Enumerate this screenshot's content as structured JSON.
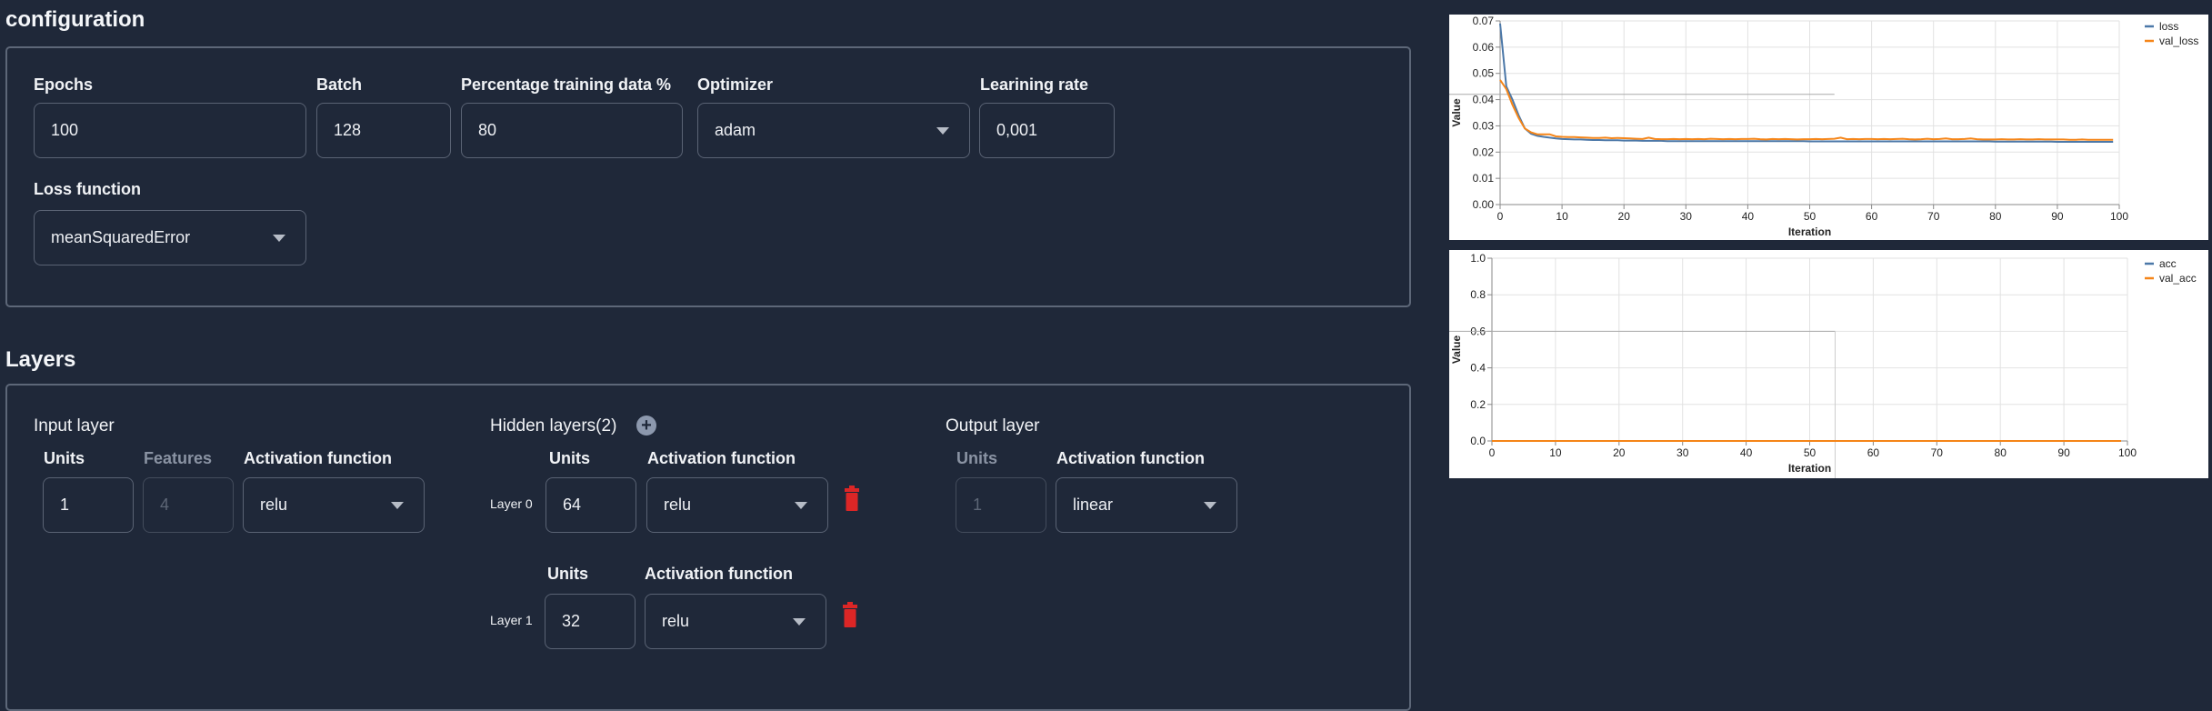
{
  "config": {
    "title": "configuration",
    "epochs": {
      "label": "Epochs",
      "value": "100"
    },
    "batch": {
      "label": "Batch",
      "value": "128"
    },
    "percentage": {
      "label": "Percentage training data %",
      "value": "80"
    },
    "optimizer": {
      "label": "Optimizer",
      "value": "adam"
    },
    "learning_rate": {
      "label": "Learining rate",
      "value": "0,001"
    },
    "loss_function": {
      "label": "Loss function",
      "value": "meanSquaredError"
    }
  },
  "layers": {
    "title": "Layers",
    "input": {
      "title": "Input layer",
      "units_label": "Units",
      "units": "1",
      "features_label": "Features",
      "features": "4",
      "activation_label": "Activation function",
      "activation": "relu"
    },
    "hidden": {
      "title": "Hidden layers(2)",
      "items": [
        {
          "name": "Layer 0",
          "units_label": "Units",
          "units": "64",
          "activation_label": "Activation function",
          "activation": "relu"
        },
        {
          "name": "Layer 1",
          "units_label": "Units",
          "units": "32",
          "activation_label": "Activation function",
          "activation": "relu"
        }
      ]
    },
    "output": {
      "title": "Output layer",
      "units_label": "Units",
      "units": "1",
      "activation_label": "Activation function",
      "activation": "linear"
    }
  },
  "colors": {
    "accent_delete": "#dc2626",
    "series_1": "#4c78a8",
    "series_2": "#f58518"
  },
  "chart_data": [
    {
      "type": "line",
      "xlabel": "Iteration",
      "ylabel": "Value",
      "xlim": [
        0,
        100
      ],
      "ylim": [
        0,
        0.07
      ],
      "xticks": [
        "0",
        "10",
        "20",
        "30",
        "40",
        "50",
        "60",
        "70",
        "80",
        "90",
        "100"
      ],
      "yticks": [
        "0.00",
        "0.01",
        "0.02",
        "0.03",
        "0.04",
        "0.05",
        "0.06",
        "0.07"
      ],
      "grid": true,
      "legend": "top-right",
      "series": [
        {
          "name": "loss",
          "values": [
            0.069,
            0.045,
            0.04,
            0.034,
            0.029,
            0.027,
            0.0262,
            0.0258,
            0.0255,
            0.0252,
            0.025,
            0.0249,
            0.0248,
            0.0248,
            0.0247,
            0.0246,
            0.0246,
            0.0245,
            0.0245,
            0.0245,
            0.0244,
            0.0244,
            0.0244,
            0.0243,
            0.0243,
            0.0243,
            0.0243,
            0.0242,
            0.0242,
            0.0242,
            0.0242,
            0.0242,
            0.0242,
            0.0242,
            0.0242,
            0.0242,
            0.0242,
            0.0242,
            0.0242,
            0.0242,
            0.0242,
            0.0242,
            0.0242,
            0.0242,
            0.0242,
            0.0242,
            0.0242,
            0.0242,
            0.0242,
            0.0242,
            0.0241,
            0.0241,
            0.0241,
            0.0241,
            0.0241,
            0.0241,
            0.0241,
            0.0241,
            0.0241,
            0.0241,
            0.0241,
            0.0241,
            0.0241,
            0.0241,
            0.0241,
            0.0241,
            0.0241,
            0.0241,
            0.0241,
            0.0241,
            0.0241,
            0.0241,
            0.0241,
            0.0241,
            0.0241,
            0.0241,
            0.0241,
            0.0241,
            0.0241,
            0.0241,
            0.024,
            0.024,
            0.024,
            0.024,
            0.024,
            0.024,
            0.024,
            0.024,
            0.024,
            0.024,
            0.0239,
            0.0239,
            0.0239,
            0.0239,
            0.0239,
            0.0239,
            0.0239,
            0.0239,
            0.0239,
            0.0239
          ]
        },
        {
          "name": "val_loss",
          "values": [
            0.0475,
            0.044,
            0.038,
            0.033,
            0.029,
            0.0275,
            0.0268,
            0.0268,
            0.0268,
            0.026,
            0.0258,
            0.0257,
            0.0257,
            0.0256,
            0.0255,
            0.0254,
            0.0254,
            0.0255,
            0.0253,
            0.0254,
            0.0253,
            0.0252,
            0.0251,
            0.025,
            0.0255,
            0.025,
            0.0249,
            0.0249,
            0.025,
            0.0249,
            0.025,
            0.0249,
            0.025,
            0.0249,
            0.0251,
            0.025,
            0.0249,
            0.025,
            0.0249,
            0.025,
            0.025,
            0.0251,
            0.0249,
            0.0248,
            0.025,
            0.0249,
            0.025,
            0.0249,
            0.0248,
            0.0249,
            0.0249,
            0.025,
            0.0249,
            0.025,
            0.0251,
            0.0255,
            0.0249,
            0.025,
            0.0249,
            0.025,
            0.025,
            0.0249,
            0.025,
            0.0249,
            0.025,
            0.0251,
            0.0249,
            0.0248,
            0.0249,
            0.0251,
            0.0249,
            0.025,
            0.0252,
            0.0249,
            0.0249,
            0.025,
            0.0252,
            0.0249,
            0.0248,
            0.0248,
            0.0248,
            0.0249,
            0.0248,
            0.0248,
            0.0249,
            0.0248,
            0.0248,
            0.0249,
            0.0248,
            0.0248,
            0.0248,
            0.0248,
            0.0247,
            0.0247,
            0.0248,
            0.0247,
            0.0247,
            0.0247,
            0.0247,
            0.0247
          ]
        }
      ]
    },
    {
      "type": "line",
      "xlabel": "Iteration",
      "ylabel": "Value",
      "xlim": [
        0,
        100
      ],
      "ylim": [
        0,
        1
      ],
      "xticks": [
        "0",
        "10",
        "20",
        "30",
        "40",
        "50",
        "60",
        "70",
        "80",
        "90",
        "100"
      ],
      "yticks": [
        "0.0",
        "0.2",
        "0.4",
        "0.6",
        "0.8",
        "1.0"
      ],
      "grid": true,
      "legend": "top-right",
      "series": [
        {
          "name": "acc",
          "values": [
            0,
            0,
            0,
            0,
            0,
            0,
            0,
            0,
            0,
            0,
            0,
            0,
            0,
            0,
            0,
            0,
            0,
            0,
            0,
            0,
            0,
            0,
            0,
            0,
            0,
            0,
            0,
            0,
            0,
            0,
            0,
            0,
            0,
            0,
            0,
            0,
            0,
            0,
            0,
            0,
            0,
            0,
            0,
            0,
            0,
            0,
            0,
            0,
            0,
            0,
            0,
            0,
            0,
            0,
            0,
            0,
            0,
            0,
            0,
            0,
            0,
            0,
            0,
            0,
            0,
            0,
            0,
            0,
            0,
            0,
            0,
            0,
            0,
            0,
            0,
            0,
            0,
            0,
            0,
            0,
            0,
            0,
            0,
            0,
            0,
            0,
            0,
            0,
            0,
            0,
            0,
            0,
            0,
            0,
            0,
            0,
            0,
            0,
            0,
            0
          ]
        },
        {
          "name": "val_acc",
          "values": [
            0,
            0,
            0,
            0,
            0,
            0,
            0,
            0,
            0,
            0,
            0,
            0,
            0,
            0,
            0,
            0,
            0,
            0,
            0,
            0,
            0,
            0,
            0,
            0,
            0,
            0,
            0,
            0,
            0,
            0,
            0,
            0,
            0,
            0,
            0,
            0,
            0,
            0,
            0,
            0,
            0,
            0,
            0,
            0,
            0,
            0,
            0,
            0,
            0,
            0,
            0,
            0,
            0,
            0,
            0,
            0,
            0,
            0,
            0,
            0,
            0,
            0,
            0,
            0,
            0,
            0,
            0,
            0,
            0,
            0,
            0,
            0,
            0,
            0,
            0,
            0,
            0,
            0,
            0,
            0,
            0,
            0,
            0,
            0,
            0,
            0,
            0,
            0,
            0,
            0,
            0,
            0,
            0,
            0,
            0,
            0,
            0,
            0,
            0,
            0
          ]
        }
      ]
    }
  ]
}
